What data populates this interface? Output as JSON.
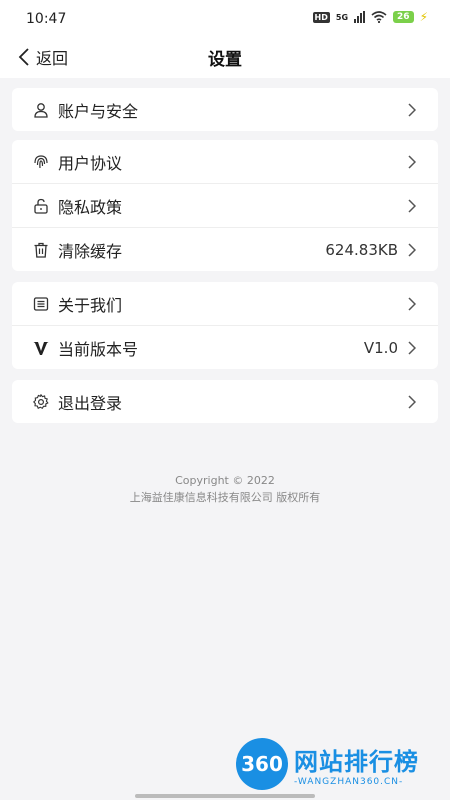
{
  "status_bar": {
    "time": "10:47",
    "network": "5G",
    "battery": "26"
  },
  "nav": {
    "back_label": "返回",
    "title": "设置"
  },
  "groups": [
    {
      "items": [
        {
          "label": "账户与安全",
          "icon": "user-icon"
        }
      ]
    },
    {
      "items": [
        {
          "label": "用户协议",
          "icon": "fingerprint-icon"
        },
        {
          "label": "隐私政策",
          "icon": "unlock-icon"
        },
        {
          "label": "清除缓存",
          "icon": "trash-icon",
          "value": "624.83KB"
        }
      ]
    },
    {
      "items": [
        {
          "label": "关于我们",
          "icon": "document-icon"
        },
        {
          "label": "当前版本号",
          "icon": "version-v-icon",
          "value": "V1.0"
        }
      ]
    },
    {
      "items": [
        {
          "label": "退出登录",
          "icon": "gear-icon"
        }
      ]
    }
  ],
  "footer": {
    "copyright": "Copyright ©  2022",
    "company": "上海益佳康信息科技有限公司 版权所有"
  },
  "watermark": {
    "logo_text": "360",
    "name": "网站排行榜",
    "url": "-WANGZHAN360.CN-"
  },
  "colors": {
    "background": "#f4f4f6",
    "card": "#ffffff",
    "watermark_blue": "#1a8fe3"
  }
}
